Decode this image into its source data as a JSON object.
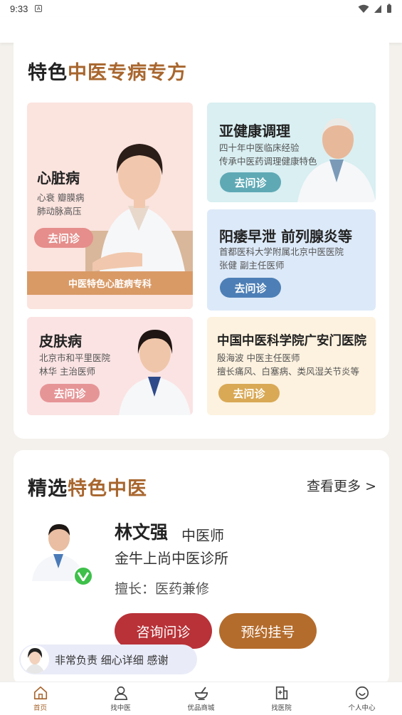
{
  "status": {
    "time": "9:33"
  },
  "feature": {
    "title_a": "特色",
    "title_b": "中医专病专方",
    "heart": {
      "title": "心脏病",
      "line1": "心衰  瓣膜病",
      "line2": "肺动脉高压",
      "button": "去问诊",
      "banner": "中医特色心脏病专科"
    },
    "subhealth": {
      "title": "亚健康调理",
      "line1": "四十年中医临床经验",
      "line2": "传承中医药调理健康特色",
      "button": "去问诊"
    },
    "yang": {
      "title": "阳痿早泄 前列腺炎等",
      "line1": "首都医科大学附属北京中医医院",
      "line2": "张健 副主任医师",
      "button": "去问诊"
    },
    "skin": {
      "title": "皮肤病",
      "line1": "北京市和平里医院",
      "line2": "林华 主治医师",
      "button": "去问诊"
    },
    "guanganmen": {
      "title": "中国中医科学院广安门医院",
      "line1": "殷海波  中医主任医师",
      "line2": "擅长痛风、白塞病、类风湿关节炎等",
      "button": "去问诊"
    }
  },
  "selected": {
    "title_a": "精选",
    "title_b": "特色中医",
    "more": "查看更多 >",
    "doctor": {
      "name": "林文强",
      "title": "中医师",
      "clinic": "金牛上尚中医诊所",
      "skill": "擅长：医药兼修"
    },
    "consult": "咨询问诊",
    "book": "预约挂号"
  },
  "review": "非常负责 细心详细 感谢",
  "tabs": [
    {
      "label": "首页",
      "icon": "home-icon"
    },
    {
      "label": "找中医",
      "icon": "doctor-icon"
    },
    {
      "label": "优品商城",
      "icon": "mortar-icon"
    },
    {
      "label": "找医院",
      "icon": "hospital-icon"
    },
    {
      "label": "个人中心",
      "icon": "profile-icon"
    }
  ],
  "colors": {
    "accent": "#a8662e",
    "consult": "#b83238",
    "book": "#b46c2c",
    "verified": "#3ec04a"
  }
}
